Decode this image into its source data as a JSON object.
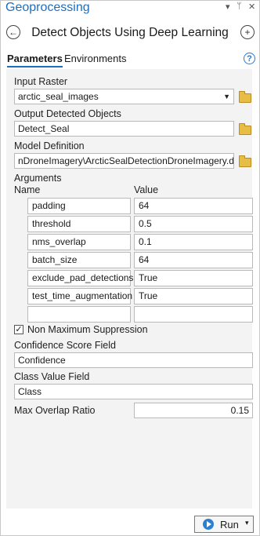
{
  "pane": {
    "title": "Geoprocessing",
    "menu_glyph": "▾",
    "pin_glyph": "ᛘ",
    "close_glyph": "✕"
  },
  "tool": {
    "title": "Detect Objects Using Deep Learning",
    "back_icon": "arrow-left-icon",
    "add_icon": "plus-icon"
  },
  "tabs": [
    {
      "label": "Parameters",
      "active": true
    },
    {
      "label": "Environments",
      "active": false
    }
  ],
  "help_glyph": "?",
  "input_raster": {
    "label": "Input Raster",
    "value": "arctic_seal_images"
  },
  "output_objects": {
    "label": "Output Detected Objects",
    "value": "Detect_Seal"
  },
  "model_definition": {
    "label": "Model Definition",
    "value": "nDroneImagery\\ArcticSealDetectionDroneImagery.dlpk"
  },
  "arguments": {
    "label": "Arguments",
    "col_name": "Name",
    "col_value": "Value",
    "rows": [
      {
        "name": "padding",
        "value": "64"
      },
      {
        "name": "threshold",
        "value": "0.5"
      },
      {
        "name": "nms_overlap",
        "value": "0.1"
      },
      {
        "name": "batch_size",
        "value": "64"
      },
      {
        "name": "exclude_pad_detections",
        "value": "True"
      },
      {
        "name": "test_time_augmentation",
        "value": "True"
      },
      {
        "name": "",
        "value": ""
      }
    ]
  },
  "nms": {
    "label": "Non Maximum Suppression",
    "checked": true,
    "check_glyph": "✓"
  },
  "confidence_field": {
    "label": "Confidence Score Field",
    "value": "Confidence"
  },
  "class_field": {
    "label": "Class Value Field",
    "value": "Class"
  },
  "max_overlap": {
    "label": "Max Overlap Ratio",
    "value": "0.15"
  },
  "run": {
    "label": "Run",
    "dropdown_glyph": "▾"
  },
  "colors": {
    "accent": "#1c6fbf",
    "folder": "#e7bd45",
    "panel_bg": "#f3f3f3"
  }
}
